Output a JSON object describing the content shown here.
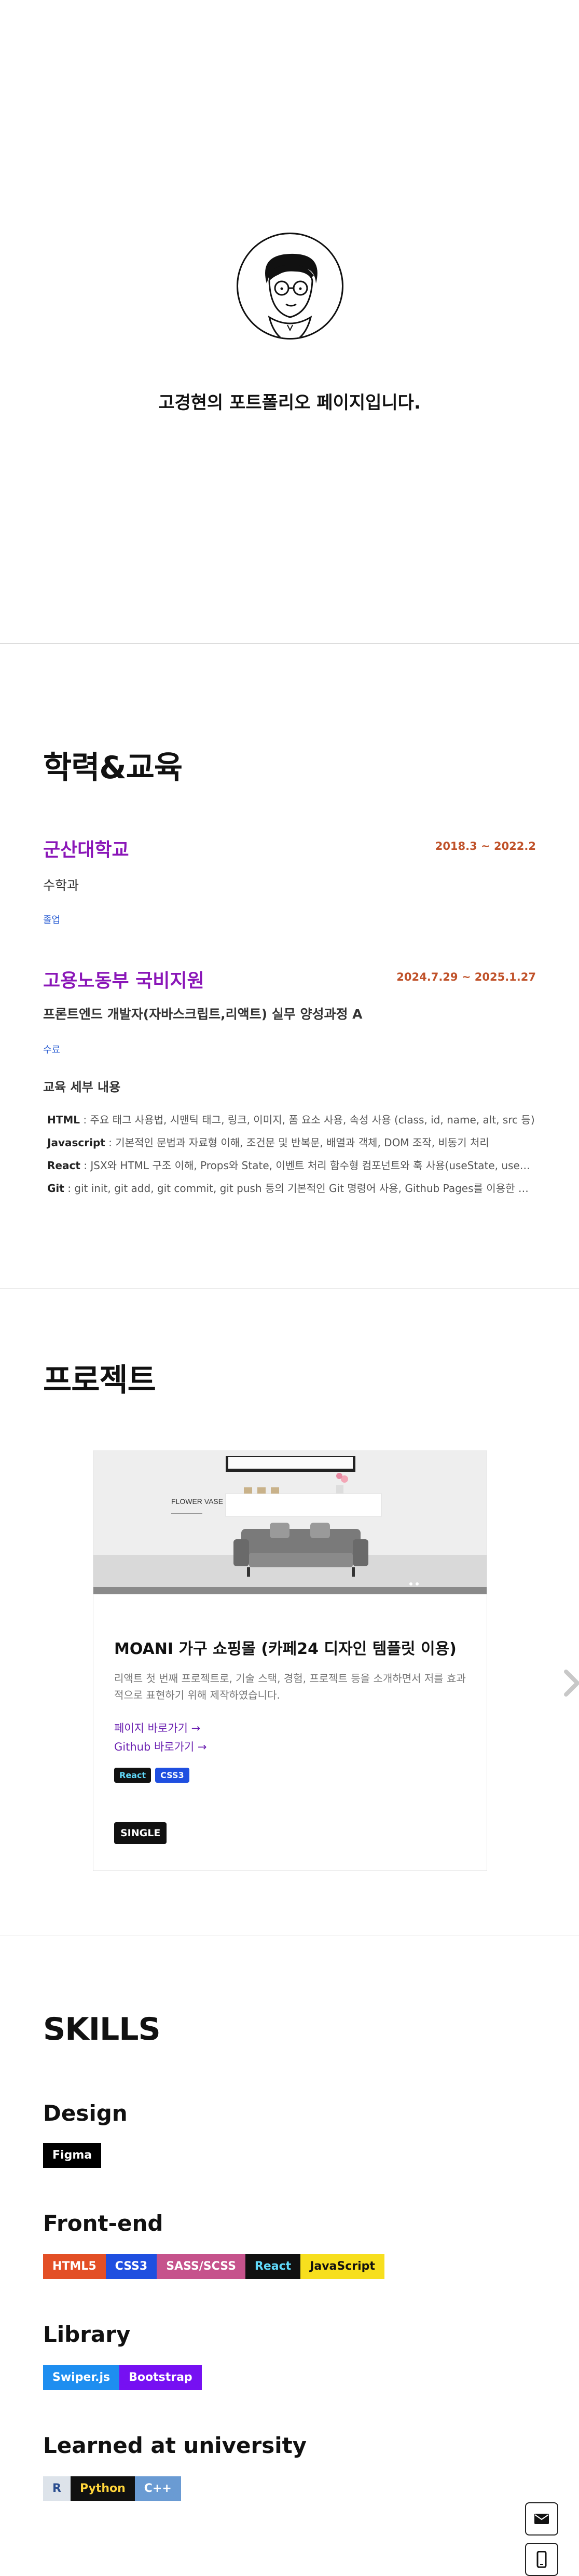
{
  "hero": {
    "title": "고경현의 포트폴리오 페이지입니다."
  },
  "education": {
    "title": "학력&교육",
    "schools": [
      {
        "name": "군산대학교",
        "date": "2018.3 ~ 2022.2",
        "major": "수학과",
        "status": "졸업"
      },
      {
        "name": "고용노동부 국비지원",
        "date": "2024.7.29 ~ 2025.1.27",
        "major": "프론트엔드 개발자(자바스크립트,리액트) 실무 양성과정 A",
        "status": "수료",
        "detail_title": "교육 세부 내용",
        "details": [
          {
            "label": "HTML",
            "text": " : 주요 태그 사용법, 시맨틱 태그, 링크, 이미지, 폼 요소 사용, 속성 사용 (class, id, name, alt, src 등)"
          },
          {
            "label": "Javascript",
            "text": " : 기본적인 문법과 자료형 이해, 조건문 및 반복문, 배열과 객체, DOM 조작, 비동기 처리"
          },
          {
            "label": "React",
            "text": " : JSX와 HTML 구조 이해, Props와 State, 이벤트 처리 함수형 컴포넌트와 훅 사용(useState, useEffect)"
          },
          {
            "label": "Git",
            "text": " : git init, git add, git commit, git push 등의 기본적인 Git 명령어 사용, Github Pages를 이용한 배포"
          }
        ]
      }
    ]
  },
  "projects": {
    "title": "프로젝트",
    "card": {
      "image_text": "FLOWER VASE",
      "title": "MOANI 가구 쇼핑몰 (카페24 디자인 템플릿 이용)",
      "description": "리액트 첫 번째 프로젝트로, 기술 스택, 경험, 프로젝트 등을 소개하면서 저를 효과적으로 표현하기 위해 제작하였습니다.",
      "link_page": "페이지 바로가기 →",
      "link_github": "Github 바로가기 →",
      "tags": [
        "React",
        "CSS3"
      ],
      "type": "SINGLE"
    },
    "next_icon": "chevron-right-icon"
  },
  "skills": {
    "title": "SKILLS",
    "categories": [
      {
        "name": "Design",
        "items": [
          {
            "label": "Figma",
            "bg": "#000000",
            "fg": "#ffffff"
          }
        ]
      },
      {
        "name": "Front-end",
        "items": [
          {
            "label": "HTML5",
            "bg": "#e34f26",
            "fg": "#ffffff"
          },
          {
            "label": "CSS3",
            "bg": "#1f4fe0",
            "fg": "#ffffff"
          },
          {
            "label": "SASS/SCSS",
            "bg": "#c6538c",
            "fg": "#ffffff"
          },
          {
            "label": "React",
            "bg": "#111111",
            "fg": "#61dafb"
          },
          {
            "label": "JavaScript",
            "bg": "#f7df1e",
            "fg": "#111111"
          }
        ]
      },
      {
        "name": "Library",
        "items": [
          {
            "label": "Swiper.js",
            "bg": "#1e8ef0",
            "fg": "#ffffff"
          },
          {
            "label": "Bootstrap",
            "bg": "#7610f2",
            "fg": "#ffffff"
          }
        ]
      },
      {
        "name": "Learned at university",
        "items": [
          {
            "label": "R",
            "bg": "#dde3ea",
            "fg": "#2a4d8f"
          },
          {
            "label": "Python",
            "bg": "#111111",
            "fg": "#ffd43b"
          },
          {
            "label": "C++",
            "bg": "#6a9bd3",
            "fg": "#ffffff"
          }
        ]
      }
    ]
  },
  "floating": {
    "mail_icon": "mail-icon",
    "phone_icon": "phone-icon"
  }
}
